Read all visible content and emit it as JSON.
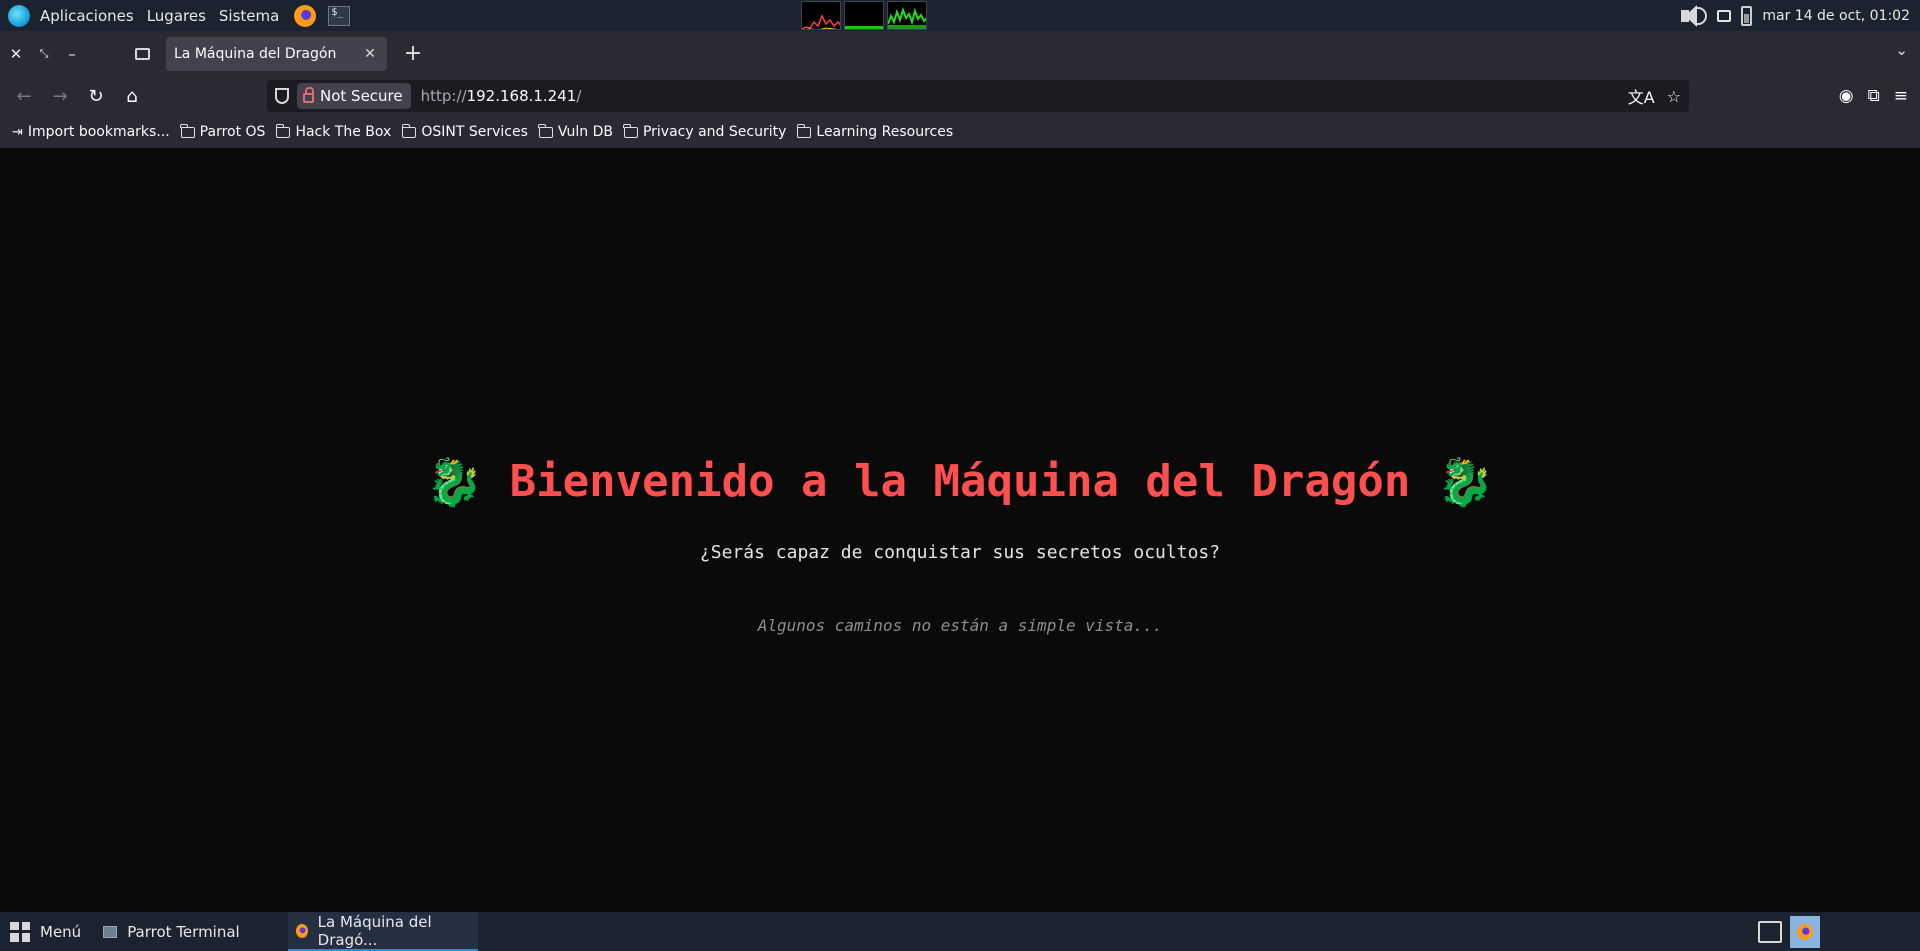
{
  "system_panel": {
    "menus": [
      "Aplicaciones",
      "Lugares",
      "Sistema"
    ],
    "clock": "mar 14 de oct, 01:02"
  },
  "browser": {
    "tab": {
      "title": "La Máquina del Dragón"
    },
    "url": {
      "security_label": "Not Secure",
      "scheme": "http://",
      "host": "192.168.1.241",
      "path": "/"
    },
    "bookmarks": [
      "Import bookmarks...",
      "Parrot OS",
      "Hack The Box",
      "OSINT Services",
      "Vuln DB",
      "Privacy and Security",
      "Learning Resources"
    ]
  },
  "page": {
    "title": "Bienvenido a la Máquina del Dragón",
    "title_icon": "🐉",
    "subtitle": "¿Serás capaz de conquistar sus secretos ocultos?",
    "hint": "Algunos caminos no están a simple vista...",
    "colors": {
      "title": "#ff4f4f",
      "background": "#0a0a0a"
    }
  },
  "taskbar": {
    "menu_label": "Menú",
    "tasks": [
      "Parrot Terminal",
      "La Máquina del Dragó..."
    ]
  }
}
